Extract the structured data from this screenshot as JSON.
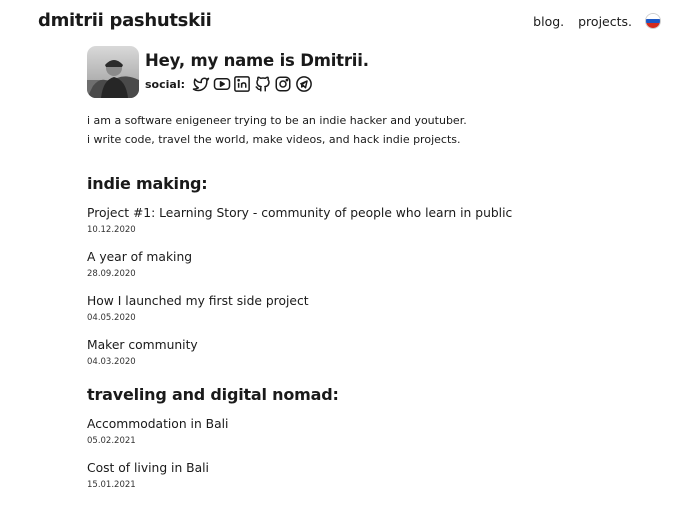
{
  "header": {
    "site_title": "dmitrii pashutskii",
    "nav": [
      {
        "label": "blog."
      },
      {
        "label": "projects."
      }
    ],
    "language_flag": "russian-flag-icon",
    "flag_colors": [
      "#ffffff",
      "#1c57c5",
      "#d52b1e"
    ]
  },
  "profile": {
    "greeting": "Hey, my name is Dmitrii.",
    "social_label": "social:",
    "social_icons": [
      "twitter-icon",
      "youtube-icon",
      "linkedin-icon",
      "github-icon",
      "instagram-icon",
      "telegram-icon"
    ]
  },
  "bio": {
    "line1": "i am a software enigeneer trying to be an indie hacker and youtuber.",
    "line2": "i write code, travel the world, make videos, and hack indie projects."
  },
  "sections": [
    {
      "title": "indie making:",
      "posts": [
        {
          "title": "Project #1: Learning Story - community of people who learn in public",
          "date": "10.12.2020"
        },
        {
          "title": "A year of making",
          "date": "28.09.2020"
        },
        {
          "title": "How I launched my first side project",
          "date": "04.05.2020"
        },
        {
          "title": "Maker community",
          "date": "04.03.2020"
        }
      ]
    },
    {
      "title": "traveling and digital nomad:",
      "posts": [
        {
          "title": "Accommodation in Bali",
          "date": "05.02.2021"
        },
        {
          "title": "Cost of living in Bali",
          "date": "15.01.2021"
        }
      ]
    }
  ]
}
